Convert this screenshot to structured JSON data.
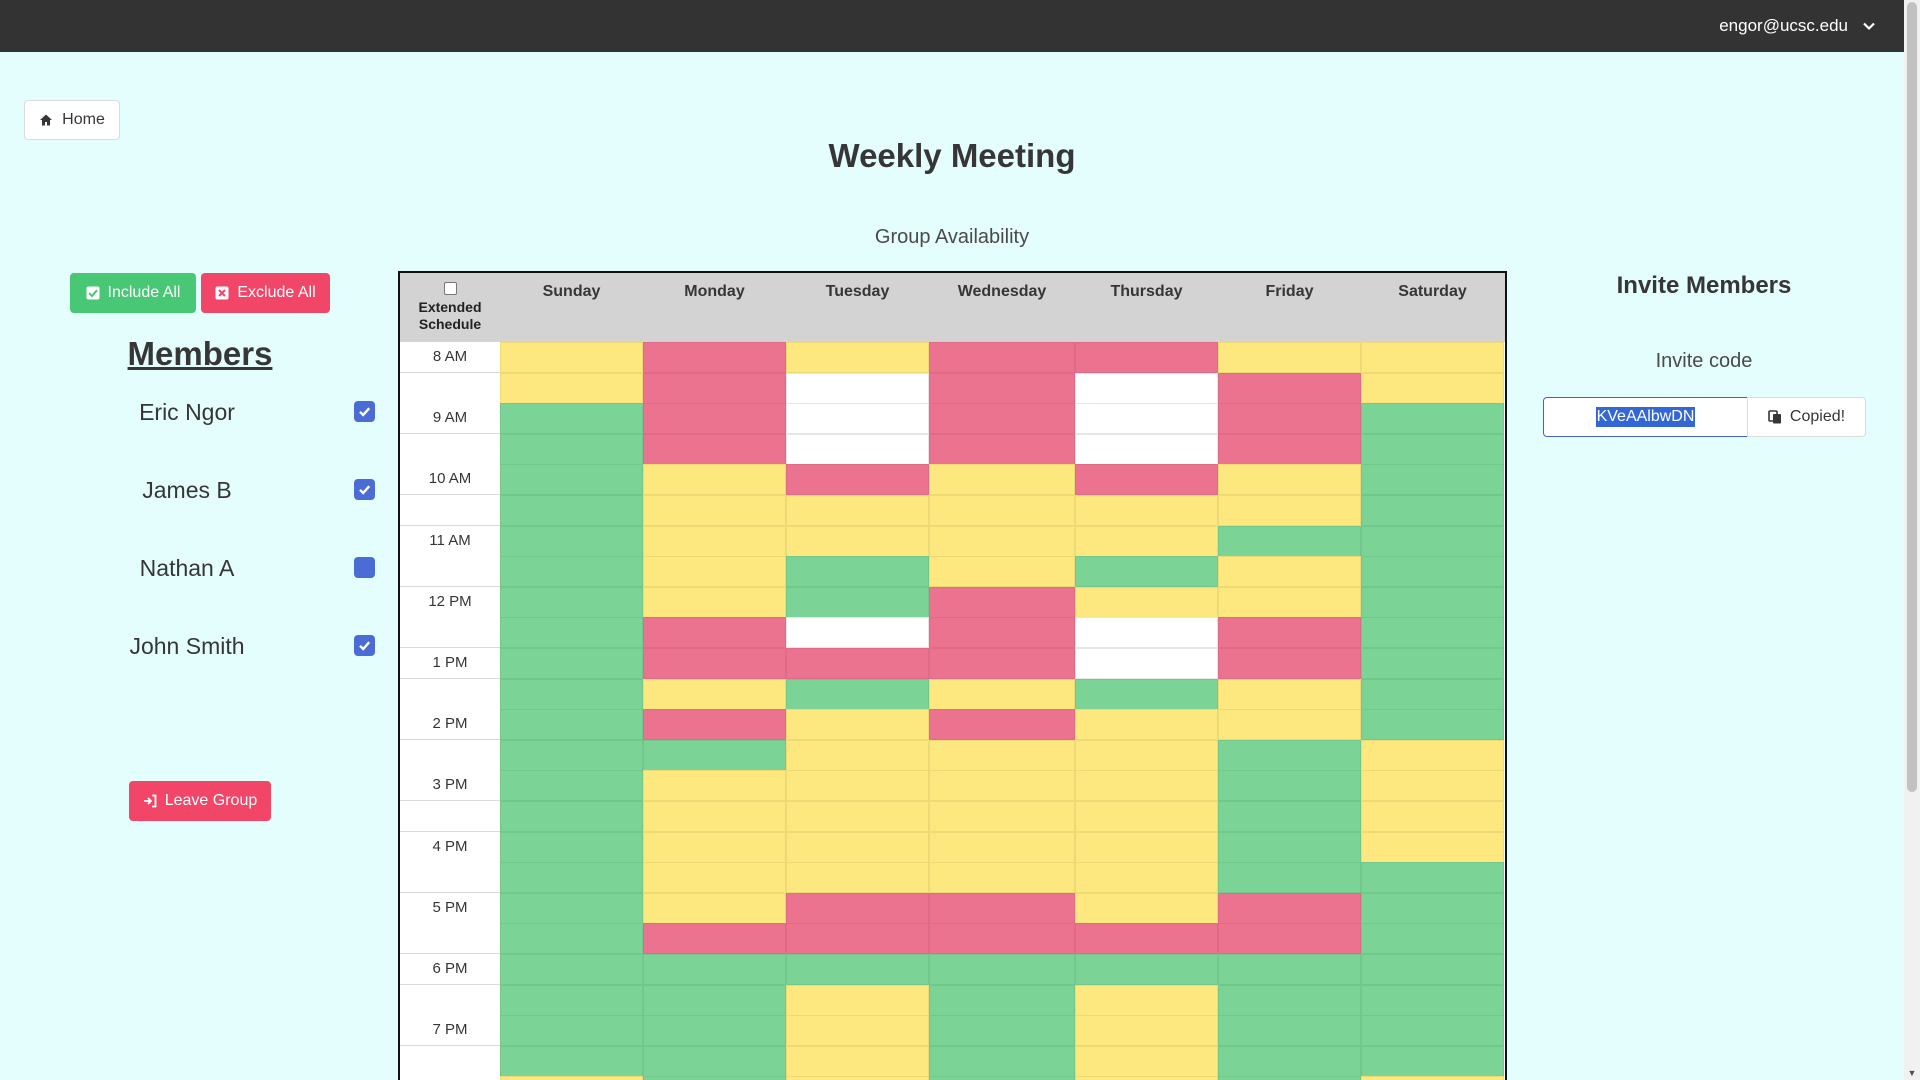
{
  "header": {
    "user_email": "engor@ucsc.edu",
    "menu_icon": "chevron-down-icon"
  },
  "nav": {
    "home_label": "Home",
    "home_icon": "home-icon"
  },
  "page": {
    "title": "Weekly Meeting",
    "subtitle": "Group Availability"
  },
  "members_panel": {
    "include_all_label": "Include All",
    "exclude_all_label": "Exclude All",
    "title": "Members",
    "members": [
      {
        "name": "Eric Ngor",
        "included": true
      },
      {
        "name": "James B",
        "included": true
      },
      {
        "name": "Nathan A",
        "included": false
      },
      {
        "name": "John Smith",
        "included": true
      }
    ],
    "leave_label": "Leave Group"
  },
  "schedule": {
    "extended_label": "Extended Schedule",
    "extended_checked": false,
    "days": [
      "Sunday",
      "Monday",
      "Tuesday",
      "Wednesday",
      "Thursday",
      "Friday",
      "Saturday"
    ],
    "time_labels": [
      "8 AM",
      "",
      "9 AM",
      "",
      "10 AM",
      "",
      "11 AM",
      "",
      "12 PM",
      "",
      "1 PM",
      "",
      "2 PM",
      "",
      "3 PM",
      "",
      "4 PM",
      "",
      "5 PM",
      "",
      "6 PM",
      "",
      "7 PM",
      "",
      ""
    ],
    "status_legend": {
      "y": "#fce87f",
      "r": "#ec7390",
      "g": "#7bd495",
      "w": "#ffffff"
    },
    "availability": [
      [
        "y",
        "r",
        "y",
        "r",
        "r",
        "y",
        "y"
      ],
      [
        "y",
        "r",
        "w",
        "r",
        "w",
        "r",
        "y"
      ],
      [
        "g",
        "r",
        "w",
        "r",
        "w",
        "r",
        "g"
      ],
      [
        "g",
        "r",
        "w",
        "r",
        "w",
        "r",
        "g"
      ],
      [
        "g",
        "y",
        "r",
        "y",
        "r",
        "y",
        "g"
      ],
      [
        "g",
        "y",
        "y",
        "y",
        "y",
        "y",
        "g"
      ],
      [
        "g",
        "y",
        "y",
        "y",
        "y",
        "g",
        "g"
      ],
      [
        "g",
        "y",
        "g",
        "y",
        "g",
        "y",
        "g"
      ],
      [
        "g",
        "y",
        "g",
        "r",
        "y",
        "y",
        "g"
      ],
      [
        "g",
        "r",
        "w",
        "r",
        "w",
        "r",
        "g"
      ],
      [
        "g",
        "r",
        "r",
        "r",
        "w",
        "r",
        "g"
      ],
      [
        "g",
        "y",
        "g",
        "y",
        "g",
        "y",
        "g"
      ],
      [
        "g",
        "r",
        "y",
        "r",
        "y",
        "y",
        "g"
      ],
      [
        "g",
        "g",
        "y",
        "y",
        "y",
        "g",
        "y"
      ],
      [
        "g",
        "y",
        "y",
        "y",
        "y",
        "g",
        "y"
      ],
      [
        "g",
        "y",
        "y",
        "y",
        "y",
        "g",
        "y"
      ],
      [
        "g",
        "y",
        "y",
        "y",
        "y",
        "g",
        "y"
      ],
      [
        "g",
        "y",
        "y",
        "y",
        "y",
        "g",
        "g"
      ],
      [
        "g",
        "y",
        "r",
        "r",
        "y",
        "r",
        "g"
      ],
      [
        "g",
        "r",
        "r",
        "r",
        "r",
        "r",
        "g"
      ],
      [
        "g",
        "g",
        "g",
        "g",
        "g",
        "g",
        "g"
      ],
      [
        "g",
        "g",
        "y",
        "g",
        "y",
        "g",
        "g"
      ],
      [
        "g",
        "g",
        "y",
        "g",
        "y",
        "g",
        "g"
      ],
      [
        "g",
        "g",
        "y",
        "g",
        "y",
        "g",
        "g"
      ],
      [
        "y",
        "g",
        "y",
        "g",
        "y",
        "g",
        "y"
      ]
    ]
  },
  "invite": {
    "title": "Invite Members",
    "subtitle": "Invite code",
    "code": "KVeAAlbwDN",
    "copy_label": "Copied!",
    "copy_icon": "clipboard-icon"
  }
}
